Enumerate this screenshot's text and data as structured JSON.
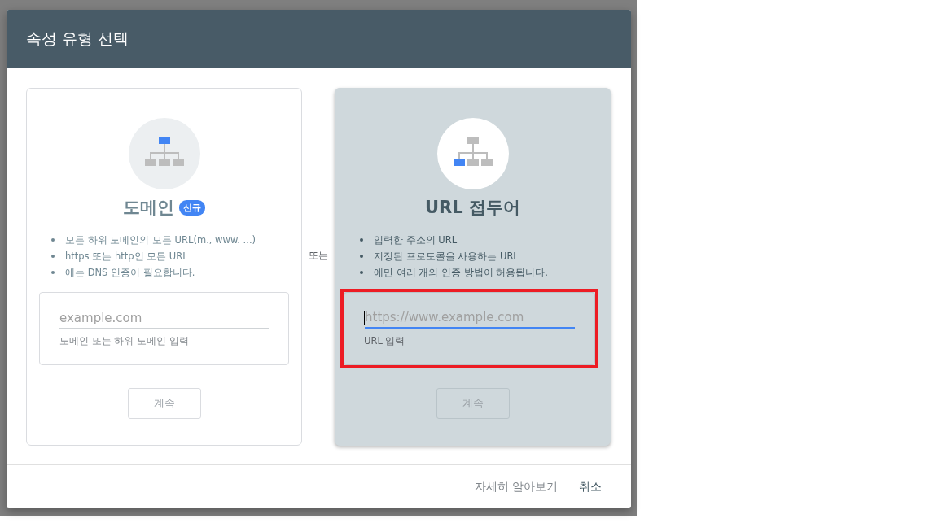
{
  "dialog": {
    "title": "속성 유형 선택",
    "options": [
      {
        "kind": "domain",
        "title": "도메인",
        "badge": "신규",
        "selected": false,
        "highlighted": false,
        "bullets": [
          "모든 하위 도메인의 모든 URL(m., www. ...)",
          "https 또는 http인 모든 URL",
          "에는 DNS 인증이 필요합니다."
        ],
        "input": {
          "placeholder": "example.com",
          "helper": "도메인 또는 하위 도메인 입력",
          "focused": false
        },
        "button": {
          "label": "계속",
          "disabled": true
        }
      },
      {
        "kind": "url-prefix",
        "title": "URL 접두어",
        "selected": true,
        "highlighted": true,
        "bullets": [
          "입력한 주소의 URL",
          "지정된 프로토콜을 사용하는 URL",
          "에만 여러 개의 인증 방법이 허용됩니다."
        ],
        "input": {
          "placeholder": "https://www.example.com",
          "helper": "URL 입력",
          "focused": true
        },
        "button": {
          "label": "계속",
          "disabled": true
        }
      }
    ],
    "separator": "또는",
    "footer_buttons": [
      {
        "label": "자세히 알아보기",
        "emphasized": false
      },
      {
        "label": "취소",
        "emphasized": true
      }
    ]
  }
}
